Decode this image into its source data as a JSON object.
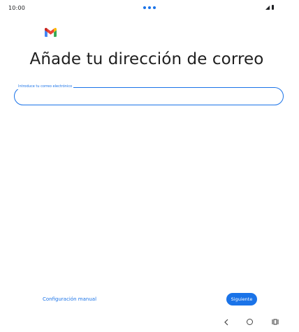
{
  "status_bar": {
    "time": "10:00"
  },
  "header": {
    "logo_icon": "gmail-icon",
    "title": "Añade tu dirección de correo"
  },
  "email_field": {
    "label": "Introduce tu correo electrónico",
    "value": ""
  },
  "footer": {
    "manual_config_label": "Configuración manual",
    "next_label": "Siguiente"
  },
  "navigation": {
    "back_icon": "back-icon",
    "home_icon": "home-icon",
    "recents_icon": "recents-icon"
  },
  "colors": {
    "accent": "#1a73e8",
    "gmail_red": "#ea4335",
    "gmail_blue": "#4285f4",
    "gmail_green": "#34a853",
    "gmail_yellow": "#fbbc04"
  }
}
